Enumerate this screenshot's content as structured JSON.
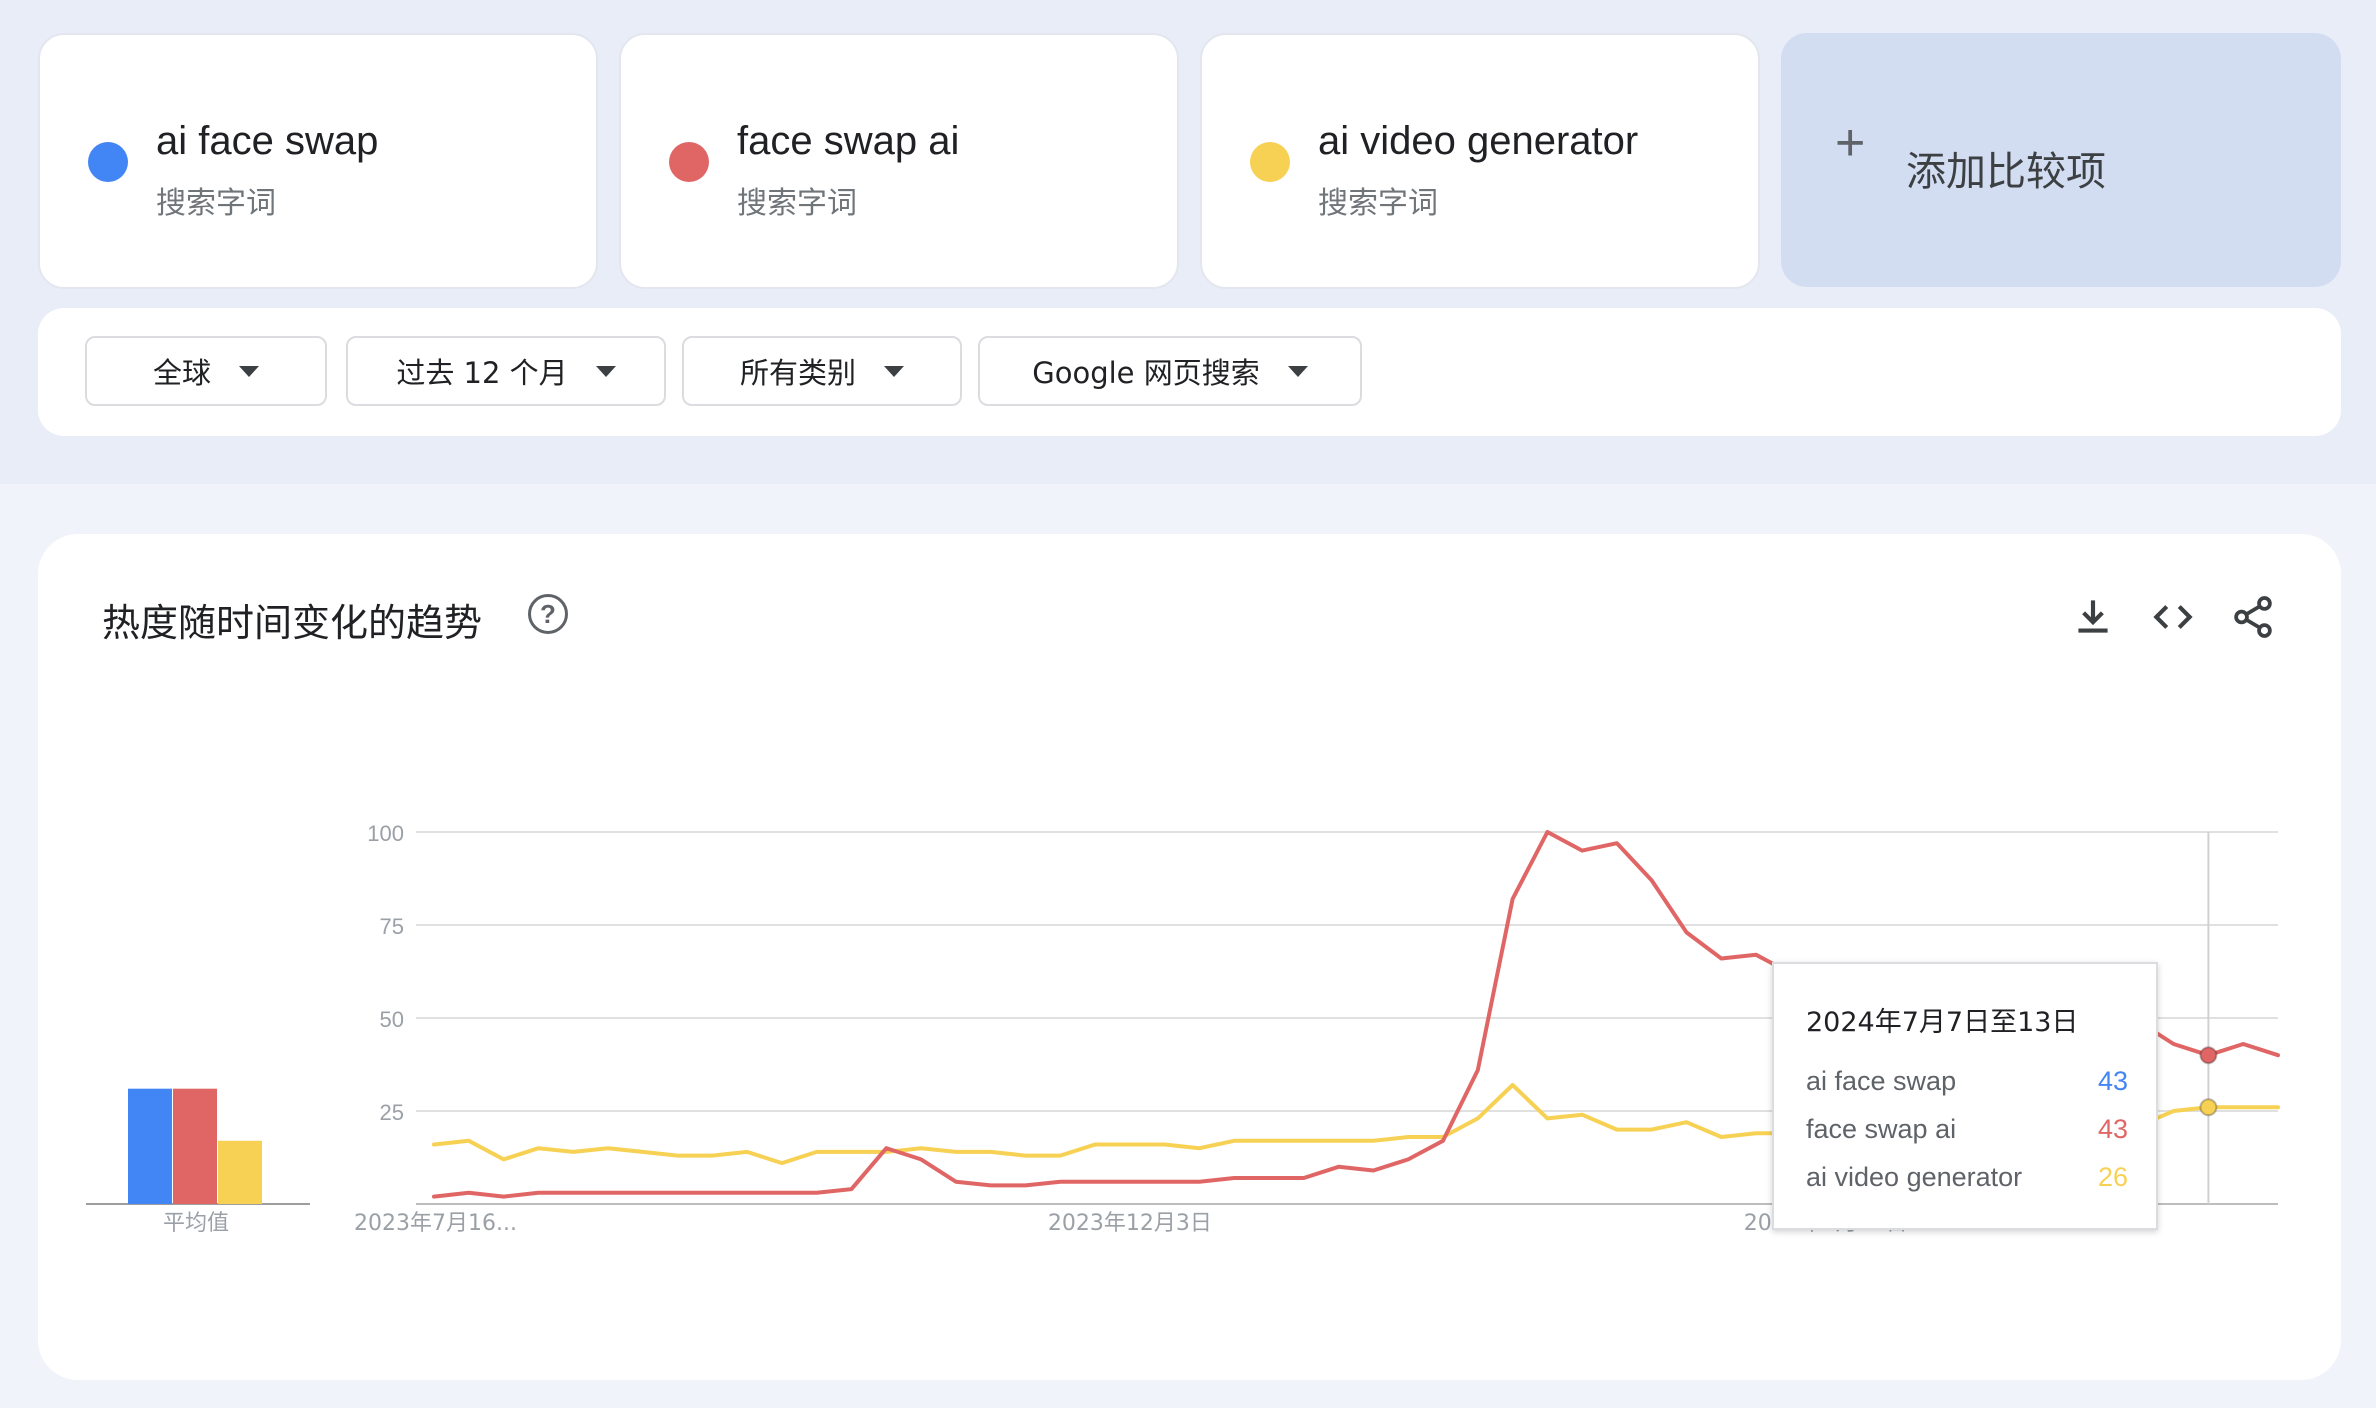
{
  "terms": [
    {
      "name": "ai face swap",
      "type": "搜索字词",
      "color": "#4285f4"
    },
    {
      "name": "face swap ai",
      "type": "搜索字词",
      "color": "#e06666"
    },
    {
      "name": "ai video generator",
      "type": "搜索字词",
      "color": "#f7d154"
    }
  ],
  "add_compare": {
    "label": "添加比较项",
    "icon": "plus-icon"
  },
  "filters": {
    "region": "全球",
    "time": "过去 12 个月",
    "category": "所有类别",
    "search_type": "Google 网页搜索"
  },
  "chart_section": {
    "title": "热度随时间变化的趋势",
    "help_icon": "help-circle-icon",
    "tools": [
      "download-icon",
      "embed-code-icon",
      "share-icon"
    ]
  },
  "tooltip": {
    "date": "2024年7月7日至13日",
    "rows": [
      {
        "name": "ai face swap",
        "value": "43",
        "color": "#4285f4"
      },
      {
        "name": "face swap ai",
        "value": "43",
        "color": "#e06666"
      },
      {
        "name": "ai video generator",
        "value": "26",
        "color": "#f7d154"
      }
    ]
  },
  "chart_data": {
    "type": "line",
    "yticks": [
      "100",
      "75",
      "50",
      "25"
    ],
    "ylim": [
      0,
      100
    ],
    "xtick_labels": [
      "2023年7月16...",
      "2023年12月3日",
      "2024年4月21日"
    ],
    "xtick_weeks": [
      0,
      20,
      40
    ],
    "weeks": 53,
    "average_label": "平均值",
    "averages": [
      {
        "name": "ai face swap",
        "value": 31,
        "color": "#4285f4"
      },
      {
        "name": "face swap ai",
        "value": 31,
        "color": "#e06666"
      },
      {
        "name": "ai video generator",
        "value": 17,
        "color": "#f7d154"
      }
    ],
    "series": [
      {
        "name": "face swap ai",
        "color": "#e06666",
        "values": [
          2,
          3,
          2,
          3,
          3,
          3,
          3,
          3,
          3,
          3,
          3,
          3,
          4,
          15,
          12,
          6,
          5,
          5,
          6,
          6,
          6,
          6,
          6,
          7,
          7,
          7,
          10,
          9,
          12,
          17,
          36,
          82,
          100,
          95,
          97,
          87,
          73,
          66,
          67,
          62,
          59,
          62,
          52,
          46,
          49,
          47,
          48,
          47,
          48,
          49,
          43,
          40,
          43,
          40
        ]
      },
      {
        "name": "ai video generator",
        "color": "#f7d154",
        "values": [
          16,
          17,
          12,
          15,
          14,
          15,
          14,
          13,
          13,
          14,
          11,
          14,
          14,
          14,
          15,
          14,
          14,
          13,
          13,
          16,
          16,
          16,
          15,
          17,
          17,
          17,
          17,
          17,
          18,
          18,
          23,
          32,
          23,
          24,
          20,
          20,
          22,
          18,
          19,
          19,
          20,
          21,
          21,
          21,
          21,
          22,
          22,
          22,
          23,
          21,
          25,
          26,
          26,
          26
        ]
      }
    ],
    "highlight_week": 51
  }
}
